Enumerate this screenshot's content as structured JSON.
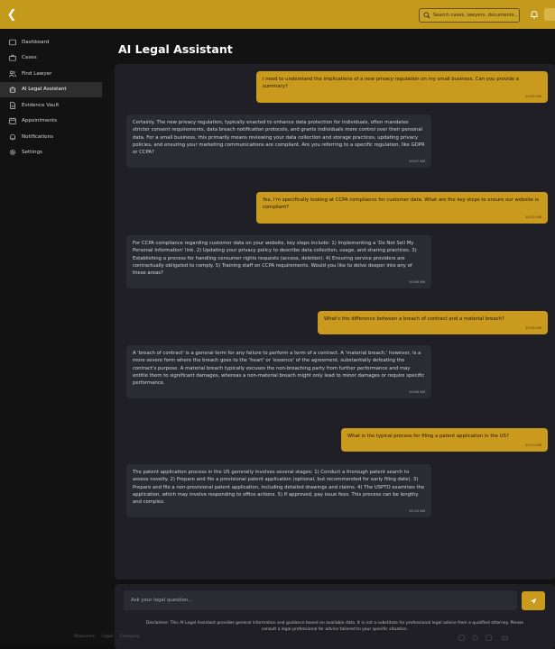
{
  "header": {
    "search_placeholder": "Search cases, lawyers, documents..."
  },
  "sidebar": {
    "items": [
      {
        "label": "Dashboard",
        "icon": "dashboard-icon"
      },
      {
        "label": "Cases",
        "icon": "briefcase-icon"
      },
      {
        "label": "Find Lawyer",
        "icon": "users-icon"
      },
      {
        "label": "AI Legal Assistant",
        "icon": "robot-icon"
      },
      {
        "label": "Evidence Vault",
        "icon": "file-icon"
      },
      {
        "label": "Appointments",
        "icon": "calendar-icon"
      },
      {
        "label": "Notifications",
        "icon": "bell-icon"
      },
      {
        "label": "Settings",
        "icon": "gear-icon"
      }
    ],
    "active": "AI Legal Assistant"
  },
  "main": {
    "title": "AI Legal Assistant"
  },
  "chat": {
    "messages": [
      {
        "role": "user",
        "text": "I need to understand the implications of a new privacy regulation on my small business. Can you provide a summary?",
        "time": "10:05 AM"
      },
      {
        "role": "ai",
        "text": "Certainly. The new privacy regulation, typically enacted to enhance data protection for individuals, often mandates stricter consent requirements, data breach notification protocols, and grants individuals more control over their personal data. For a small business, this primarily means reviewing your data collection and storage practices, updating privacy policies, and ensuring your marketing communications are compliant. Are you referring to a specific regulation, like GDPR or CCPA?",
        "time": "10:07 AM"
      },
      {
        "role": "user",
        "text": "Yes, I'm specifically looking at CCPA compliance for customer data. What are the key steps to ensure our website is compliant?",
        "time": "10:12 AM"
      },
      {
        "role": "ai",
        "text": "For CCPA compliance regarding customer data on your website, key steps include: 1) Implementing a 'Do Not Sell My Personal Information' link. 2) Updating your privacy policy to describe data collection, usage, and sharing practices. 3) Establishing a process for handling consumer rights requests (access, deletion). 4) Ensuring service providers are contractually obligated to comply. 5) Training staff on CCPA requirements. Would you like to delve deeper into any of these areas?",
        "time": "10:08 AM"
      },
      {
        "role": "user",
        "text": "What's the difference between a breach of contract and a material breach?",
        "time": "10:05 AM"
      },
      {
        "role": "ai",
        "text": "A 'breach of contract' is a general term for any failure to perform a term of a contract. A 'material breach,' however, is a more severe form where the breach goes to the 'heart' or 'essence' of the agreement, substantially defeating the contract's purpose. A material breach typically excuses the non-breaching party from further performance and may entitle them to significant damages, whereas a non-material breach might only lead to minor damages or require specific performance.",
        "time": "10:06 AM"
      },
      {
        "role": "user",
        "text": "What is the typical process for filing a patent application in the US?",
        "time": "10:13 AM"
      },
      {
        "role": "ai",
        "text": "The patent application process in the US generally involves several stages: 1) Conduct a thorough patent search to assess novelty. 2) Prepare and file a provisional patent application (optional, but recommended for early filing date). 3) Prepare and file a non-provisional patent application, including detailed drawings and claims. 4) The USPTO examines the application, which may involve responding to office actions. 5) If approved, pay issue fees. This process can be lengthy and complex.",
        "time": "10:14 AM"
      }
    ]
  },
  "composer": {
    "placeholder": "Ask your legal question...",
    "disclaimer": "Disclaimer: This AI Legal Assistant provides general information and guidance based on available data. It is not a substitute for professional legal advice from a qualified attorney. Please consult a legal professional for advice tailored to your specific situation."
  },
  "footer": {
    "links": [
      "Resources",
      "Legal",
      "Company"
    ]
  },
  "colors": {
    "accent": "#c99a1d",
    "topbar": "#c49a1c",
    "panel": "#1f1f25",
    "bubble_ai": "#2b2c33",
    "background": "#121212"
  }
}
